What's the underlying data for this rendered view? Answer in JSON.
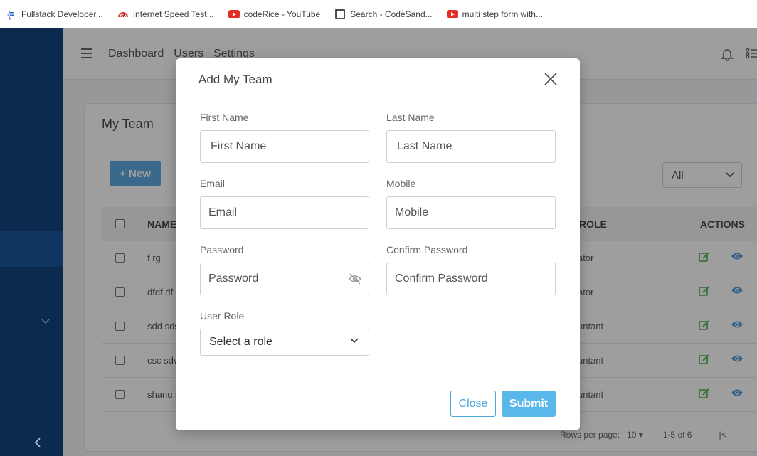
{
  "bookmarks": [
    {
      "label": "Fullstack Developer...",
      "icon": "doc-brackets-icon"
    },
    {
      "label": "Internet Speed Test...",
      "icon": "speedometer-icon"
    },
    {
      "label": "codeRice - YouTube",
      "icon": "youtube-icon"
    },
    {
      "label": "Search - CodeSand...",
      "icon": "codesandbox-icon"
    },
    {
      "label": "multi step form with...",
      "icon": "youtube-icon"
    }
  ],
  "nav": {
    "items": [
      "Dashboard",
      "Users",
      "Settings"
    ]
  },
  "card": {
    "title": "My Team",
    "new_button": "+ New",
    "filter_value": "All",
    "headers": {
      "name": "NAME",
      "role": "R ROLE",
      "actions": "ACTIONS"
    },
    "rows": [
      {
        "name": "f rg",
        "role": "ator"
      },
      {
        "name": "dfdf df",
        "role": "ator"
      },
      {
        "name": "sdd sds",
        "role": "untant"
      },
      {
        "name": "csc sdv",
        "role": "untant"
      },
      {
        "name": "shanu s",
        "role": "untant"
      }
    ],
    "footer": {
      "rows_per_page_label": "Rows per page:",
      "rows_per_page": "10",
      "range": "1-5 of 6"
    }
  },
  "modal": {
    "title": "Add My Team",
    "first_name": {
      "label": "First Name",
      "placeholder": "First Name"
    },
    "last_name": {
      "label": "Last Name",
      "placeholder": "Last Name"
    },
    "email": {
      "label": "Email",
      "placeholder": "Email"
    },
    "mobile": {
      "label": "Mobile",
      "placeholder": "Mobile"
    },
    "password": {
      "label": "Password",
      "placeholder": "Password"
    },
    "confirm_password": {
      "label": "Confirm Password",
      "placeholder": "Confirm Password"
    },
    "user_role": {
      "label": "User Role",
      "value": "Select a role"
    },
    "close_button": "Close",
    "submit_button": "Submit"
  },
  "colors": {
    "sidebar": "#0b2a4e",
    "primary": "#4aa8dc",
    "submit": "#5ab7ea",
    "edit": "#4caf50",
    "view": "#3a8fd8"
  }
}
